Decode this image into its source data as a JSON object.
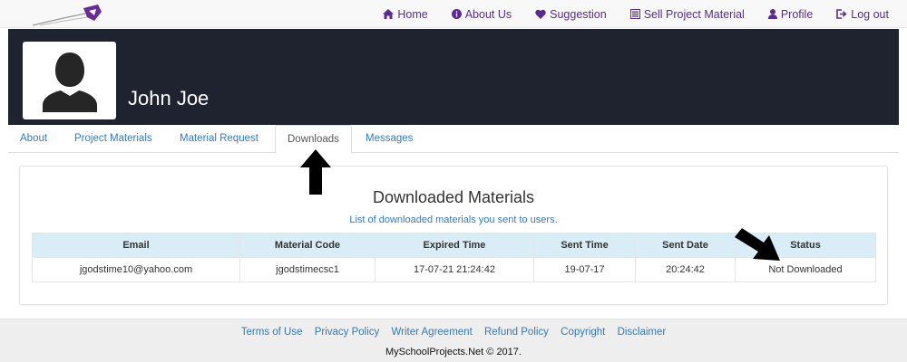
{
  "nav": {
    "items": [
      {
        "label": "Home",
        "icon": "home-icon"
      },
      {
        "label": "About Us",
        "icon": "info-icon"
      },
      {
        "label": "Suggestion",
        "icon": "heart-icon"
      },
      {
        "label": "Sell Project Material",
        "icon": "list-icon"
      },
      {
        "label": "Profile",
        "icon": "user-icon"
      },
      {
        "label": "Log out",
        "icon": "logout-icon"
      }
    ],
    "color": "#5a2a8c"
  },
  "profile": {
    "name": "John Joe"
  },
  "tabs": [
    {
      "label": "About"
    },
    {
      "label": "Project Materials"
    },
    {
      "label": "Material Request"
    },
    {
      "label": "Downloads",
      "active": true
    },
    {
      "label": "Messages"
    }
  ],
  "downloads": {
    "title": "Downloaded Materials",
    "subtitle": "List of downloaded materials you sent to users.",
    "columns": [
      "Email",
      "Material Code",
      "Expired Time",
      "Sent Time",
      "Sent Date",
      "Status"
    ],
    "rows": [
      [
        "jgodstime10@yahoo.com",
        "jgodstimecsc1",
        "17-07-21 21:24:42",
        "19-07-17",
        "20:24:42",
        "Not Downloaded"
      ]
    ]
  },
  "footer": {
    "links": [
      "Terms of Use",
      "Privacy Policy",
      "Writer Agreement",
      "Refund Policy",
      "Copyright",
      "Disclaimer"
    ],
    "copyright": "MySchoolProjects.Net © 2017."
  },
  "colors": {
    "header_bg": "#1f2330",
    "link": "#337ab7",
    "table_header_bg": "#d9edf7"
  }
}
